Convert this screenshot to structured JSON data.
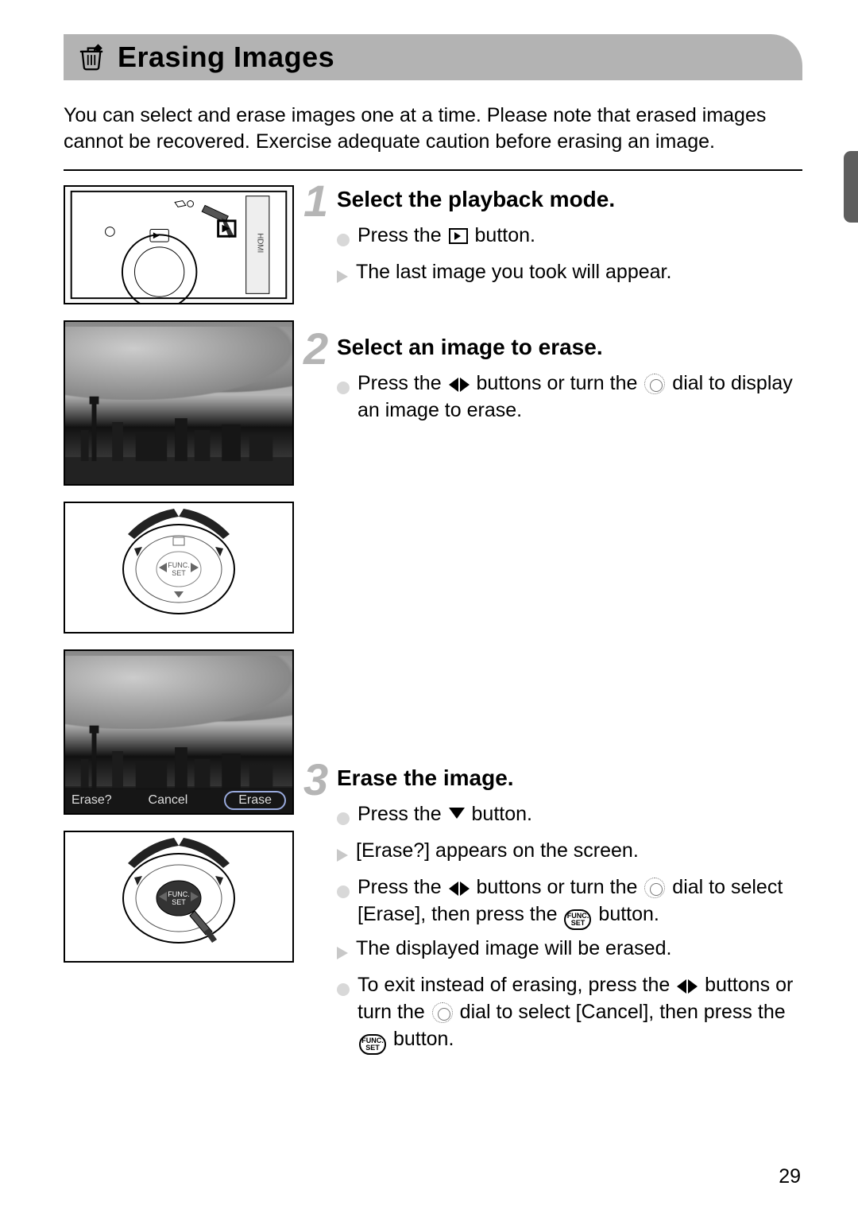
{
  "header": {
    "icon_name": "trash-icon",
    "title": "Erasing Images"
  },
  "intro": "You can select and erase images one at a time. Please note that erased images cannot be recovered. Exercise adequate caution before erasing an image.",
  "steps": [
    {
      "num": "1",
      "title": "Select the playback mode.",
      "lines": [
        {
          "mark": "circle",
          "parts": [
            "Press the ",
            {
              "icon": "playback"
            },
            " button."
          ]
        },
        {
          "mark": "tri",
          "parts": [
            "The last image you took will appear."
          ]
        }
      ]
    },
    {
      "num": "2",
      "title": "Select an image to erase.",
      "lines": [
        {
          "mark": "circle",
          "parts": [
            "Press the ",
            {
              "icon": "lr"
            },
            " buttons or turn the ",
            {
              "icon": "ring"
            },
            " dial to display an image to erase."
          ]
        }
      ]
    },
    {
      "num": "3",
      "title": "Erase the image.",
      "lines": [
        {
          "mark": "circle",
          "parts": [
            "Press the ",
            {
              "icon": "down"
            },
            " button."
          ]
        },
        {
          "mark": "tri",
          "parts": [
            "[Erase?] appears on the screen."
          ]
        },
        {
          "mark": "circle",
          "parts": [
            "Press the ",
            {
              "icon": "lr"
            },
            " buttons or turn the ",
            {
              "icon": "ring"
            },
            " dial to select [Erase], then press the ",
            {
              "icon": "func"
            },
            " button."
          ]
        },
        {
          "mark": "tri",
          "parts": [
            "The displayed image will be erased."
          ]
        },
        {
          "mark": "circle",
          "parts": [
            "To exit instead of erasing, press the ",
            {
              "icon": "lr"
            },
            " buttons or turn the ",
            {
              "icon": "ring"
            },
            " dial to select [Cancel], then press the ",
            {
              "icon": "func"
            },
            " button."
          ]
        }
      ]
    }
  ],
  "erase_prompt": {
    "question": "Erase?",
    "cancel": "Cancel",
    "erase": "Erase"
  },
  "func_label": {
    "top": "FUNC.",
    "bottom": "SET"
  },
  "page_number": "29"
}
